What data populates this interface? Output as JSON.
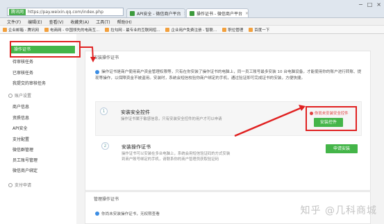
{
  "browser": {
    "address_badge": "腾讯网",
    "address_url": "https://pay.weixin.qq.com/index.php",
    "tabs": [
      {
        "label": "API安全 - 微信商户平台"
      },
      {
        "label": "操作证书 - 微信商户平台"
      }
    ],
    "window_controls": [
      "−",
      "□",
      "×"
    ],
    "menu": [
      "文件(F)",
      "编辑(E)",
      "查看(V)",
      "收藏夹(A)",
      "工具(T)",
      "帮助(H)"
    ],
    "favorites": [
      "企业邮箱 - 腾讯网",
      "电商网 - 中国领先的电商互...",
      "拉勾网 - 最专业的互联网招...",
      "企业用户免费注册 - 智联...",
      "职位管理",
      "百度一下"
    ]
  },
  "sidebar": {
    "active_item": "操作证书",
    "items_top": [
      "待审核任务",
      "已审核任务",
      "我提交的审核任务"
    ],
    "section_account": "账户设置",
    "items_account": [
      "商户信息",
      "资质信息",
      "API安全",
      "支付配置",
      "微信群管理",
      "员工账号管理",
      "微信商户绑定"
    ],
    "section_pay": "支付申请"
  },
  "main": {
    "section_title": "安装操作证书",
    "notice": "操作证书是商户使用商户资金管理权限等，只有在你安装了操作证书的电脑上，同一员工账号最多安装 10 台电脑设备，才能使用你的账户进行转账、提现等操作，以保障资金不被盗用。安装时，系统会短信校验你商户绑定的手机，通过验证即可完成证书的安装，方便快捷。",
    "step1": {
      "number": "1",
      "title": "安装安全控件",
      "desc": "操作证书属于敏感信息，只有安装安全控件的用户才可以申请",
      "warning": "你尚未安装安全控件",
      "button": "安装控件"
    },
    "step2": {
      "number": "2",
      "title": "安装操作证书",
      "desc": "操作证书可以安装在多台电脑上，系统会用短信验证码的方式安装到商户账号绑定的手机，请联系你的商户管理员获取验证码",
      "button": "申请安装"
    }
  },
  "manage": {
    "title": "管理操作证书",
    "text": "你尚未安装操作证书，无权限查看"
  },
  "watermark": "知乎 @几科商城"
}
